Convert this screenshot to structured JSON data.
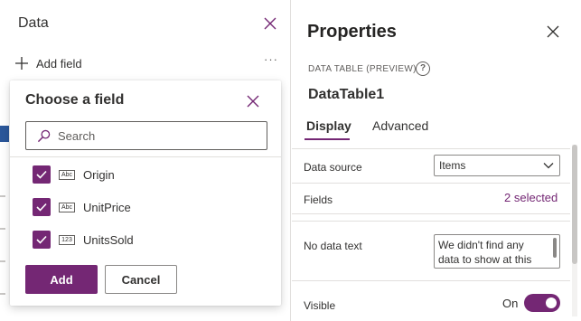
{
  "data_panel": {
    "title": "Data",
    "add_field_label": "Add field",
    "more_label": "···"
  },
  "choose_field": {
    "title": "Choose a field",
    "search_placeholder": "Search",
    "fields": [
      {
        "label": "Origin",
        "type_icon": "Abc",
        "checked": true
      },
      {
        "label": "UnitPrice",
        "type_icon": "Abc",
        "checked": true
      },
      {
        "label": "UnitsSold",
        "type_icon": "123",
        "checked": true
      }
    ],
    "add_label": "Add",
    "cancel_label": "Cancel"
  },
  "properties": {
    "title": "Properties",
    "control_type": "DATA TABLE (PREVIEW)",
    "info_icon": "?",
    "control_name": "DataTable1",
    "tabs": [
      {
        "label": "Display",
        "active": true
      },
      {
        "label": "Advanced",
        "active": false
      }
    ],
    "data_source": {
      "label": "Data source",
      "value": "Items"
    },
    "fields": {
      "label": "Fields",
      "selected_text": "2 selected"
    },
    "no_data_text": {
      "label": "No data text",
      "value": "We didn't find any data to show at this"
    },
    "visible": {
      "label": "Visible",
      "state_text": "On",
      "on": true
    }
  },
  "colors": {
    "accent": "#742774",
    "text": "#323130",
    "border": "#8a8886",
    "divider": "#e1dfdd"
  }
}
